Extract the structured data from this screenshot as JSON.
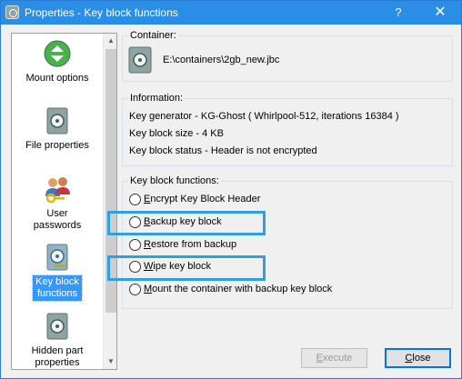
{
  "window": {
    "title": "Properties - Key block functions"
  },
  "titlebar": {
    "help_glyph": "?",
    "close_glyph": "✕"
  },
  "sidebar": {
    "items": [
      {
        "label": "Mount options",
        "icon": "eject-icon"
      },
      {
        "label": "File properties",
        "icon": "safe-icon"
      },
      {
        "label": "User passwords",
        "icon": "users-key-icon"
      },
      {
        "label": "Key block functions",
        "icon": "key-block-icon",
        "selected": true
      },
      {
        "label": "Hidden part properties",
        "icon": "safe-icon"
      }
    ]
  },
  "container_group": {
    "title": "Container:",
    "path": "E:\\containers\\2gb_new.jbc"
  },
  "info_group": {
    "title": "Information:",
    "lines": [
      "Key generator - KG-Ghost ( Whirlpool-512, iterations 16384 )",
      "Key block size - 4 KB",
      "Key block status - Header is not encrypted"
    ]
  },
  "functions_group": {
    "title": "Key block functions:",
    "options": [
      {
        "prefix": "",
        "access": "E",
        "rest": "ncrypt Key Block Header"
      },
      {
        "prefix": "",
        "access": "B",
        "rest": "ackup key block"
      },
      {
        "prefix": "",
        "access": "R",
        "rest": "estore from backup"
      },
      {
        "prefix": "",
        "access": "W",
        "rest": "ipe key block"
      },
      {
        "prefix": "",
        "access": "M",
        "rest": "ount the container with backup key block"
      }
    ]
  },
  "buttons": {
    "execute": {
      "access": "E",
      "rest": "xecute"
    },
    "close": {
      "access": "C",
      "rest": "lose"
    }
  },
  "colors": {
    "titlebar": "#2b8ee6",
    "selection": "#3399ff",
    "highlight_box": "#2ea0e0"
  }
}
